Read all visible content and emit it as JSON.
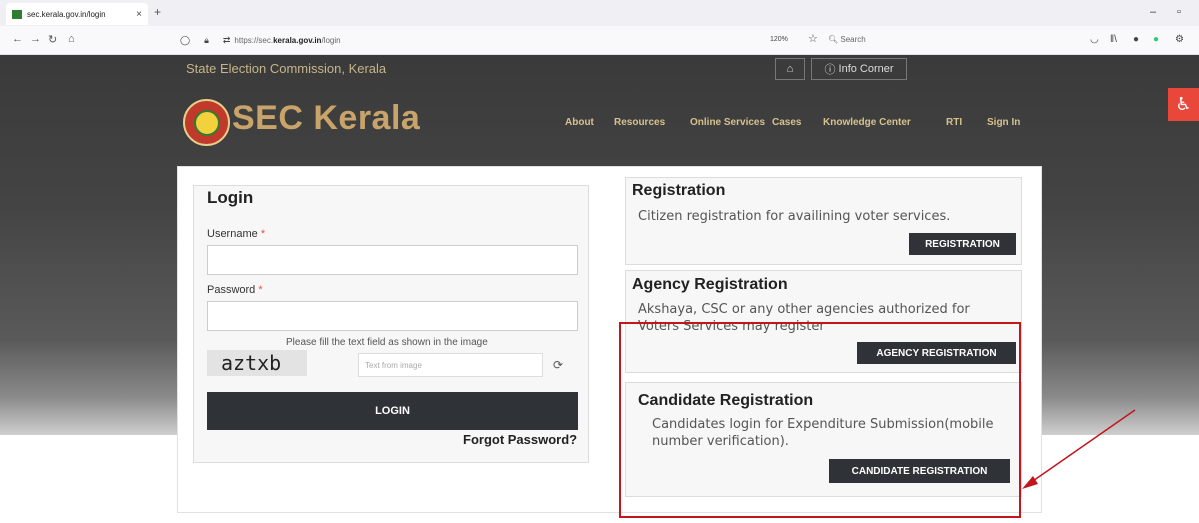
{
  "browser": {
    "tab_title": "sec.kerala.gov.in/login",
    "tab_close": "×",
    "new_tab": "+",
    "url_prefix": "https://sec.",
    "url_domain": "kerala.gov.in",
    "url_path": "/login",
    "zoom": "120%",
    "search_placeholder": "Search",
    "minimize": "–",
    "maximize": "▫"
  },
  "site": {
    "org_name": "State Election Commission, Kerala",
    "brand": "SEC Kerala",
    "home_icon": "home-icon",
    "info_corner": "Info Corner",
    "menu": [
      "About",
      "Resources",
      "Online Services",
      "Cases",
      "Knowledge Center",
      "RTI",
      "Sign In"
    ]
  },
  "login": {
    "title": "Login",
    "username_label": "Username",
    "password_label": "Password",
    "required_mark": "*",
    "captcha_hint": "Please fill the text field as shown in the image",
    "captcha_text": "aztxb",
    "captcha_placeholder": "Text from image",
    "login_button": "LOGIN",
    "forgot_password": "Forgot Password?"
  },
  "registration": {
    "title": "Registration",
    "desc": "Citizen registration for availining voter services.",
    "button": "REGISTRATION"
  },
  "agency_registration": {
    "title": "Agency Registration",
    "desc": "Akshaya, CSC or any other agencies authorized for Voters Services may register",
    "button": "AGENCY REGISTRATION"
  },
  "candidate_registration": {
    "title": "Candidate Registration",
    "desc": "Candidates login for Expenditure Submission(mobile number verification).",
    "button": "CANDIDATE REGISTRATION"
  },
  "colors": {
    "annotation": "#c0161c",
    "dark_button": "#2f3237",
    "brand_gold": "#c8a46a"
  }
}
